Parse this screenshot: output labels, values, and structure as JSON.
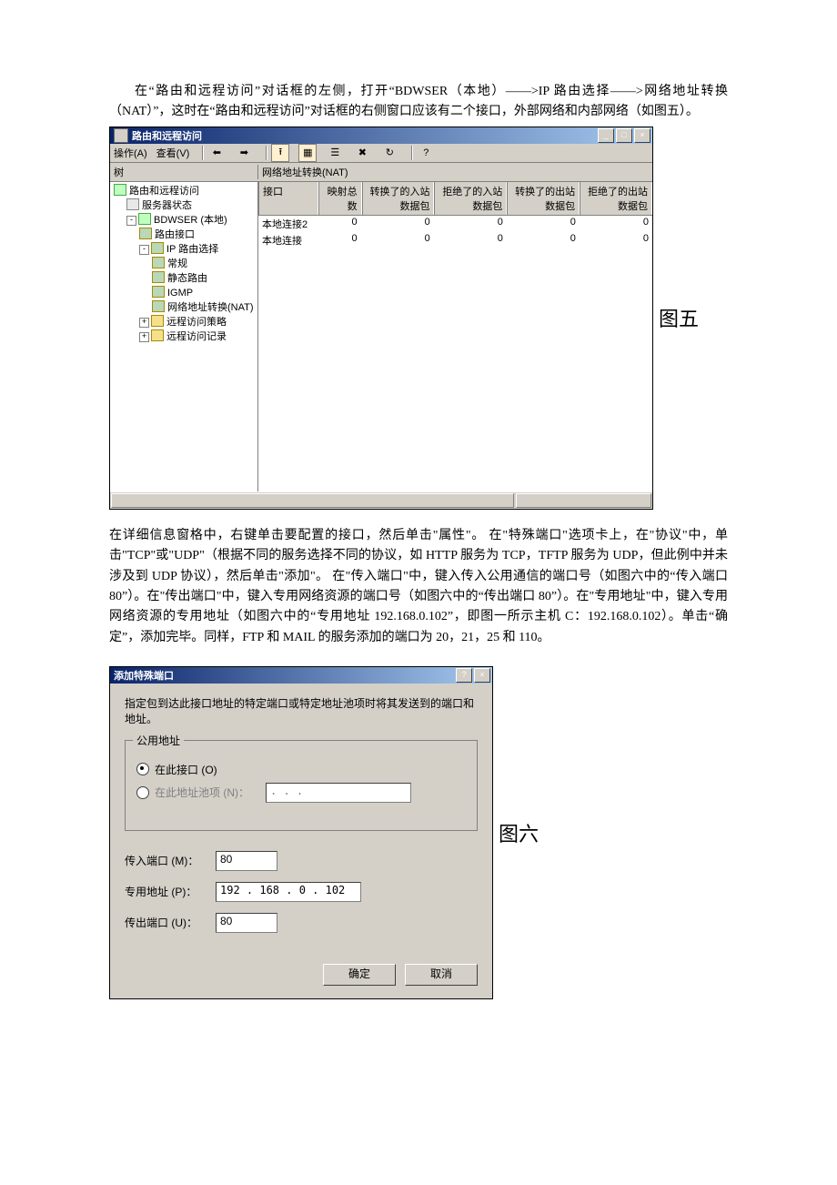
{
  "para1": "在“路由和远程访问”对话框的左侧，打开“BDWSER（本地）——>IP 路由选择——>网络地址转换（NAT）”，这时在“路由和远程访问”对话框的右侧窗口应该有二个接口，外部网络和内部网络（如图五）。",
  "fig5_label": "图五",
  "win5": {
    "title": "路由和远程访问",
    "menu_action": "操作(A)",
    "menu_view": "查看(V)",
    "left_header": "树",
    "right_header": "网络地址转换(NAT)",
    "tree": {
      "root": "路由和远程访问",
      "n1": "服务器状态",
      "n2": "BDWSER (本地)",
      "n2a": "路由接口",
      "n2b": "IP 路由选择",
      "n2b1": "常规",
      "n2b2": "静态路由",
      "n2b3": "IGMP",
      "n2b4": "网络地址转换(NAT)",
      "n2c": "远程访问策略",
      "n2d": "远程访问记录"
    },
    "cols": {
      "c1": "接口",
      "c2": "映射总数",
      "c3": "转换了的入站数据包",
      "c4": "拒绝了的入站数据包",
      "c5": "转换了的出站数据包",
      "c6": "拒绝了的出站数据包"
    },
    "rows": [
      {
        "c1": "本地连接2",
        "c2": "0",
        "c3": "0",
        "c4": "0",
        "c5": "0",
        "c6": "0"
      },
      {
        "c1": "本地连接",
        "c2": "0",
        "c3": "0",
        "c4": "0",
        "c5": "0",
        "c6": "0"
      }
    ]
  },
  "para2": "在详细信息窗格中，右键单击要配置的接口，然后单击\"属性\"。 在\"特殊端口\"选项卡上，在\"协议\"中，单击\"TCP\"或\"UDP\"（根据不同的服务选择不同的协议，如 HTTP 服务为 TCP，TFTP 服务为 UDP，但此例中并未涉及到 UDP 协议），然后单击\"添加\"。 在\"传入端口\"中，键入传入公用通信的端口号（如图六中的“传入端口 80”）。在\"传出端口\"中，键入专用网络资源的端口号（如图六中的“传出端口 80”）。在\"专用地址\"中，键入专用网络资源的专用地址（如图六中的“专用地址 192.168.0.102”，即图一所示主机 C：192.168.0.102）。单击“确定”，添加完毕。同样，FTP 和 MAIL 的服务添加的端口为 20，21，25 和 110。",
  "fig6_label": "图六",
  "dlg6": {
    "title": "添加特殊端口",
    "desc": "指定包到达此接口地址的特定端口或特定地址池项时将其发送到的端口和地址。",
    "group_legend": "公用地址",
    "radio1": "在此接口 (O)",
    "radio2": "在此地址池项 (N)：",
    "pool_value": "  .   .   .   ",
    "in_port_label": "传入端口 (M)：",
    "in_port_value": "80",
    "priv_addr_label": "专用地址 (P)：",
    "priv_addr_value": "192 . 168 .  0  . 102",
    "out_port_label": "传出端口 (U)：",
    "out_port_value": "80",
    "ok": "确定",
    "cancel": "取消"
  }
}
